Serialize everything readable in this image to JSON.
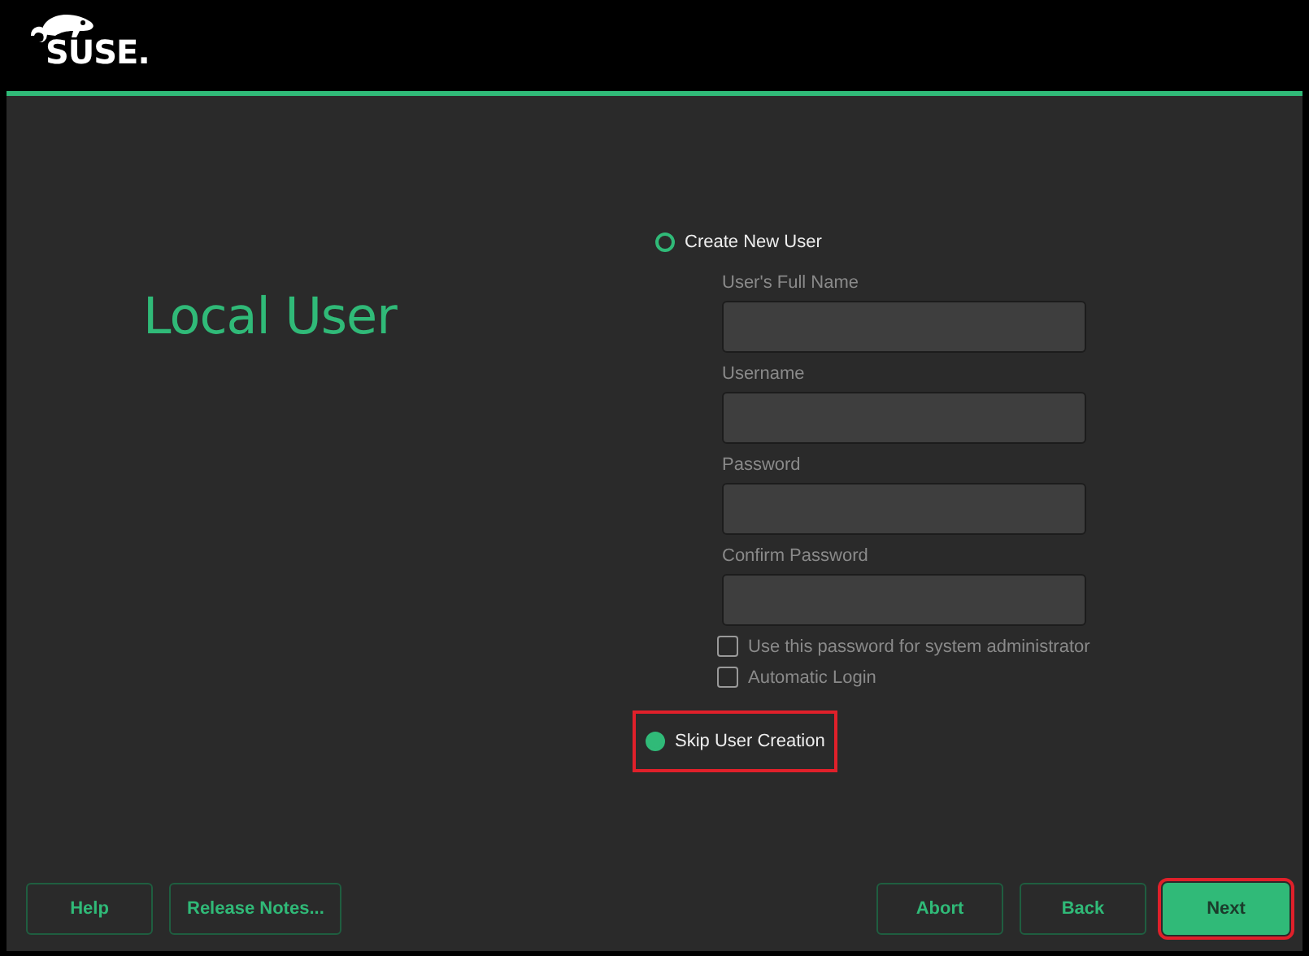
{
  "header": {
    "logo_text": "SUSE."
  },
  "page": {
    "title": "Local User"
  },
  "options": [
    {
      "label": "Create New User",
      "selected": false,
      "highlighted": false
    },
    {
      "label": "Skip User Creation",
      "selected": true,
      "highlighted": true
    }
  ],
  "fields": [
    {
      "label": "User's Full Name",
      "disabled": true
    },
    {
      "label": "Username",
      "disabled": true
    },
    {
      "label": "Password",
      "disabled": true
    },
    {
      "label": "Confirm Password",
      "disabled": true
    }
  ],
  "checkboxes": [
    {
      "label": "Use this password for system administrator",
      "checked": false,
      "disabled": true
    },
    {
      "label": "Automatic Login",
      "checked": false,
      "disabled": true
    }
  ],
  "buttons_left": [
    {
      "label": "Help",
      "primary": false,
      "highlighted": false
    },
    {
      "label": "Release Notes...",
      "primary": false,
      "highlighted": false
    }
  ],
  "buttons_right": [
    {
      "label": "Abort",
      "primary": false,
      "highlighted": false
    },
    {
      "label": "Back",
      "primary": false,
      "highlighted": false
    },
    {
      "label": "Next",
      "primary": true,
      "highlighted": true
    }
  ]
}
